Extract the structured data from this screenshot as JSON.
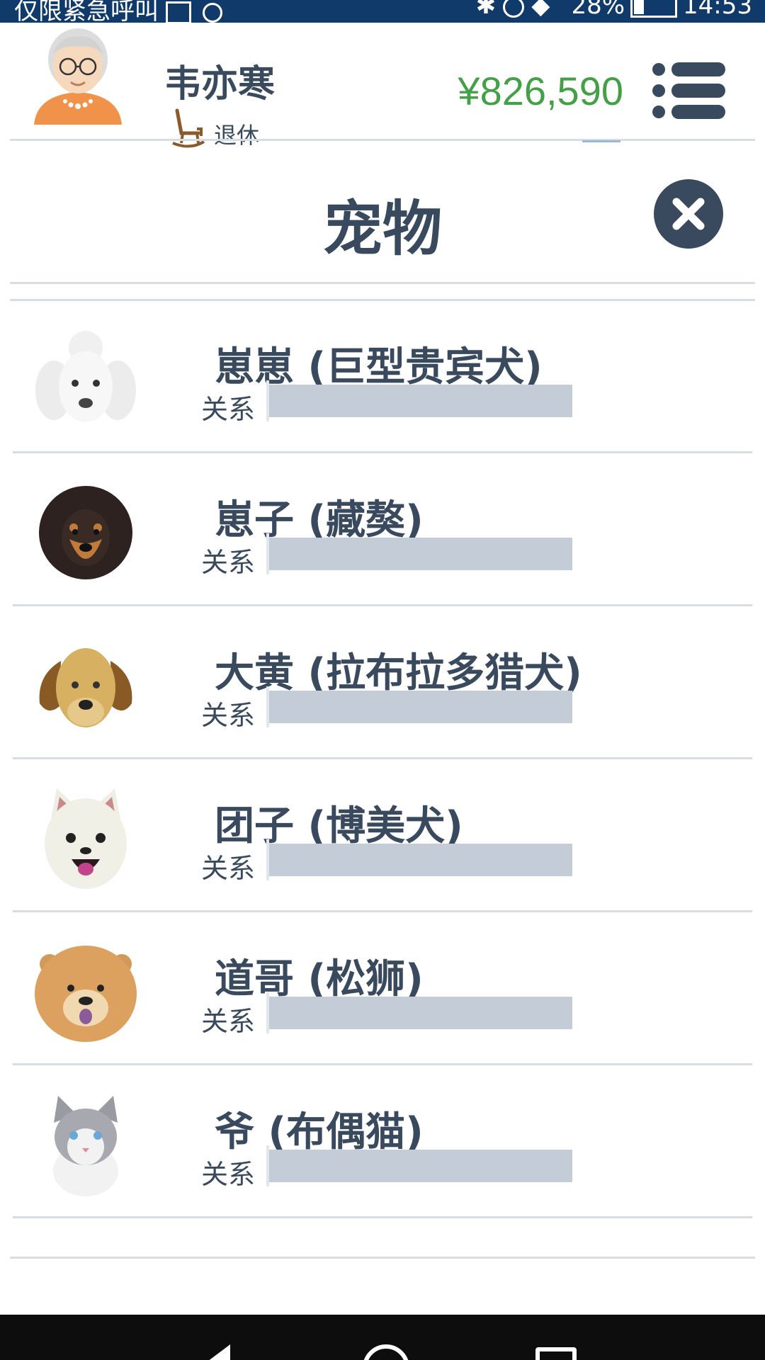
{
  "status_bar": {
    "left_text": "仅限紧急呼叫",
    "battery": "28%",
    "time": "14:53"
  },
  "header": {
    "user_name": "韦亦寒",
    "user_status": "退休",
    "money": "¥826,590",
    "avatar_icon": "grandmother-avatar",
    "status_icon": "rocking-chair-icon",
    "menu_icon": "menu-list-icon"
  },
  "page": {
    "title": "宠物",
    "close_icon": "close-icon"
  },
  "colors": {
    "primary": "#3a4a5e",
    "money": "#43a047",
    "bar": "#c4cdd7",
    "separator": "#d8dde3"
  },
  "pets": [
    {
      "name": "崽崽 (巨型贵宾犬)",
      "relation_label": "关系",
      "relation": 0,
      "icon": "poodle-icon"
    },
    {
      "name": "崽子 (藏獒)",
      "relation_label": "关系",
      "relation": 0,
      "icon": "mastiff-icon"
    },
    {
      "name": "大黄 (拉布拉多猎犬)",
      "relation_label": "关系",
      "relation": 0,
      "icon": "labrador-icon"
    },
    {
      "name": "团子 (博美犬)",
      "relation_label": "关系",
      "relation": 0,
      "icon": "pomeranian-icon"
    },
    {
      "name": "道哥 (松狮)",
      "relation_label": "关系",
      "relation": 0,
      "icon": "chow-chow-icon"
    },
    {
      "name": "爷 (布偶猫)",
      "relation_label": "关系",
      "relation": 0,
      "icon": "ragdoll-cat-icon"
    }
  ]
}
